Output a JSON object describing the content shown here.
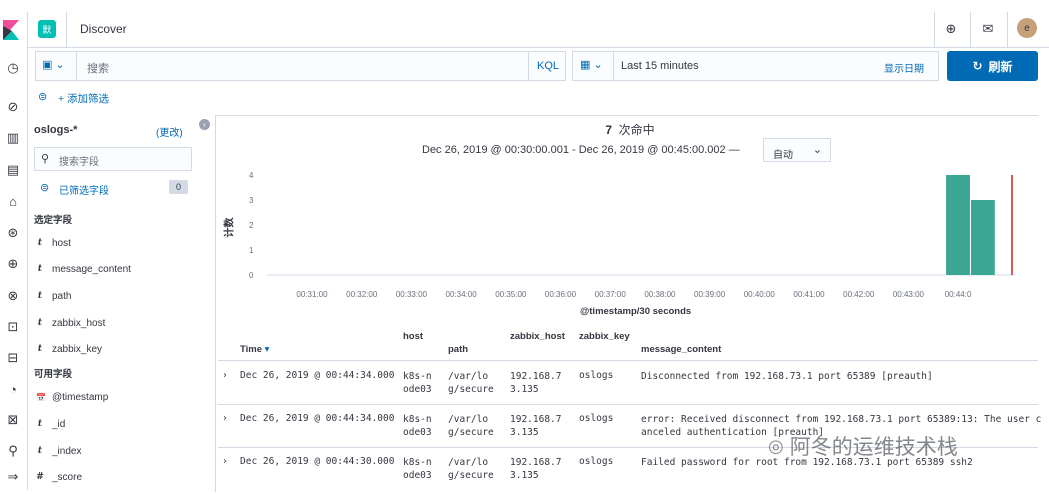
{
  "header": {
    "app_badge": "默",
    "title": "Discover",
    "avatar_letter": "e"
  },
  "query": {
    "placeholder": "搜索",
    "kql": "KQL",
    "time_range": "Last 15 minutes",
    "show_dates": "显示日期",
    "refresh": "刷新"
  },
  "filters": {
    "add_filter": "+ 添加筛选"
  },
  "sidebar": {
    "index_pattern": "oslogs-*",
    "change": "(更改)",
    "search_placeholder": "搜索字段",
    "filtered_fields": "已筛选字段",
    "filtered_count": "0",
    "selected_title": "选定字段",
    "selected_fields": [
      {
        "type": "t",
        "name": "host"
      },
      {
        "type": "t",
        "name": "message_content"
      },
      {
        "type": "t",
        "name": "path"
      },
      {
        "type": "t",
        "name": "zabbix_host"
      },
      {
        "type": "t",
        "name": "zabbix_key"
      }
    ],
    "available_title": "可用字段",
    "available_fields": [
      {
        "type": "📅",
        "name": "@timestamp"
      },
      {
        "type": "t",
        "name": "_id"
      },
      {
        "type": "t",
        "name": "_index"
      },
      {
        "type": "#",
        "name": "_score"
      }
    ]
  },
  "hits": {
    "count": "7",
    "label": "次命中"
  },
  "interval": {
    "range": "Dec 26, 2019 @ 00:30:00.001 - Dec 26, 2019 @ 00:45:00.002 —",
    "selected": "自动"
  },
  "chart_data": {
    "type": "bar",
    "ylabel": "计数",
    "xlabel": "@timestamp/30 seconds",
    "yticks": [
      "4",
      "3",
      "2",
      "1",
      "0"
    ],
    "xticks": [
      "00:31:00",
      "00:32:00",
      "00:33:00",
      "00:34:00",
      "00:35:00",
      "00:36:00",
      "00:37:00",
      "00:38:00",
      "00:39:00",
      "00:40:00",
      "00:41:00",
      "00:42:00",
      "00:43:00",
      "00:44:0"
    ],
    "ylim": [
      0,
      4
    ],
    "bars": [
      {
        "x": "00:44:00",
        "value": 4
      },
      {
        "x": "00:44:30",
        "value": 3
      }
    ],
    "color": "#3aa693"
  },
  "table": {
    "headers": {
      "time": "Time",
      "host": "host",
      "path": "path",
      "zabbix_host": "zabbix_host",
      "zabbix_key": "zabbix_key",
      "message": "message_content"
    },
    "rows": [
      {
        "time": "Dec 26, 2019 @ 00:44:34.000",
        "host1": "k8s-n",
        "host2": "ode03",
        "path1": "/var/lo",
        "path2": "g/secure",
        "zh1": "192.168.7",
        "zh2": "3.135",
        "key": "oslogs",
        "msg1": "Disconnected from 192.168.73.1 port 65389 [preauth]",
        "msg2": ""
      },
      {
        "time": "Dec 26, 2019 @ 00:44:34.000",
        "host1": "k8s-n",
        "host2": "ode03",
        "path1": "/var/lo",
        "path2": "g/secure",
        "zh1": "192.168.7",
        "zh2": "3.135",
        "key": "oslogs",
        "msg1": "error: Received disconnect from 192.168.73.1 port 65389:13: The user c",
        "msg2": "anceled authentication  [preauth]"
      },
      {
        "time": "Dec 26, 2019 @ 00:44:30.000",
        "host1": "k8s-n",
        "host2": "ode03",
        "path1": "/var/lo",
        "path2": "g/secure",
        "zh1": "192.168.7",
        "zh2": "3.135",
        "key": "oslogs",
        "msg1": "Failed password for root from 192.168.73.1 port 65389 ssh2",
        "msg2": ""
      }
    ]
  },
  "watermark": "阿冬的运维技术栈",
  "colors": {
    "primary": "#006bb4",
    "accent": "#00bfb3",
    "bar": "#3aa693",
    "border": "#d3dae6"
  }
}
